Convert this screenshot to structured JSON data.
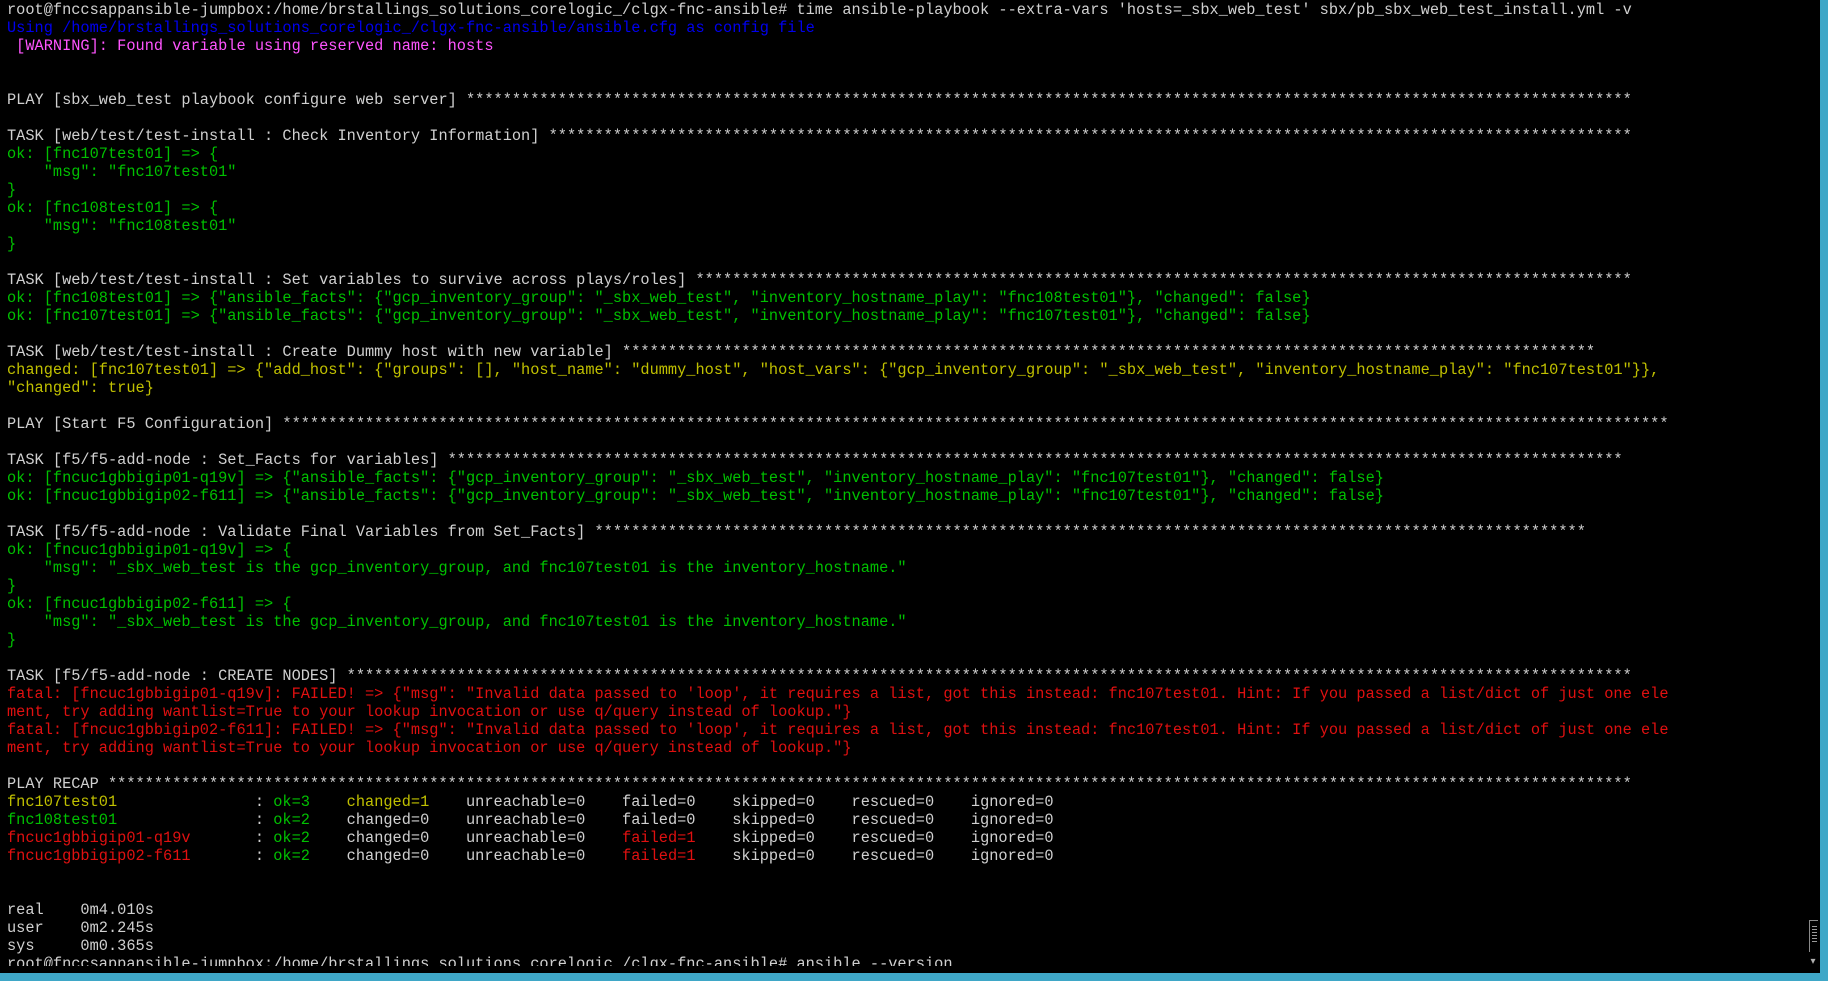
{
  "colors": {
    "default": "#d0d0d0",
    "info_blue": "#0000ee",
    "warning": "#ff55ff",
    "ok": "#00c000",
    "changed": "#c0c000",
    "fatal": "#e01010"
  },
  "icons": {
    "scroll_down": "▾"
  },
  "lines": [
    [
      {
        "t": "root@fnccsappansible-jumpbox:/home/brstallings_solutions_corelogic_/clgx-fnc-ansible# time ansible-playbook --extra-vars 'hosts=_sbx_web_test' sbx/pb_sbx_web_test_install.yml -v",
        "c": "default"
      }
    ],
    [
      {
        "t": "Using /home/brstallings_solutions_corelogic_/clgx-fnc-ansible/ansible.cfg as config file",
        "c": "info_blue"
      }
    ],
    [
      {
        "t": " [WARNING]: Found variable using reserved name: hosts",
        "c": "warning"
      }
    ],
    [],
    [],
    [
      {
        "t": "PLAY [sbx_web_test playbook configure web server] *******************************************************************************************************************************",
        "c": "default"
      }
    ],
    [],
    [
      {
        "t": "TASK [web/test/test-install : Check Inventory Information] **********************************************************************************************************************",
        "c": "default"
      }
    ],
    [
      {
        "t": "ok: [fnc107test01] => {",
        "c": "ok"
      }
    ],
    [
      {
        "t": "    \"msg\": \"fnc107test01\"",
        "c": "ok"
      }
    ],
    [
      {
        "t": "}",
        "c": "ok"
      }
    ],
    [
      {
        "t": "ok: [fnc108test01] => {",
        "c": "ok"
      }
    ],
    [
      {
        "t": "    \"msg\": \"fnc108test01\"",
        "c": "ok"
      }
    ],
    [
      {
        "t": "}",
        "c": "ok"
      }
    ],
    [],
    [
      {
        "t": "TASK [web/test/test-install : Set variables to survive across plays/roles] ******************************************************************************************************",
        "c": "default"
      }
    ],
    [
      {
        "t": "ok: [fnc108test01] => {\"ansible_facts\": {\"gcp_inventory_group\": \"_sbx_web_test\", \"inventory_hostname_play\": \"fnc108test01\"}, \"changed\": false}",
        "c": "ok"
      }
    ],
    [
      {
        "t": "ok: [fnc107test01] => {\"ansible_facts\": {\"gcp_inventory_group\": \"_sbx_web_test\", \"inventory_hostname_play\": \"fnc107test01\"}, \"changed\": false}",
        "c": "ok"
      }
    ],
    [],
    [
      {
        "t": "TASK [web/test/test-install : Create Dummy host with new variable] **********************************************************************************************************",
        "c": "default"
      }
    ],
    [
      {
        "t": "changed: [fnc107test01] => {\"add_host\": {\"groups\": [], \"host_name\": \"dummy_host\", \"host_vars\": {\"gcp_inventory_group\": \"_sbx_web_test\", \"inventory_hostname_play\": \"fnc107test01\"}},",
        "c": "changed"
      }
    ],
    [
      {
        "t": "\"changed\": true}",
        "c": "changed"
      }
    ],
    [],
    [
      {
        "t": "PLAY [Start F5 Configuration] *******************************************************************************************************************************************************",
        "c": "default"
      }
    ],
    [],
    [
      {
        "t": "TASK [f5/f5-add-node : Set_Facts for variables] ********************************************************************************************************************************",
        "c": "default"
      }
    ],
    [
      {
        "t": "ok: [fncuc1gbbigip01-q19v] => {\"ansible_facts\": {\"gcp_inventory_group\": \"_sbx_web_test\", \"inventory_hostname_play\": \"fnc107test01\"}, \"changed\": false}",
        "c": "ok"
      }
    ],
    [
      {
        "t": "ok: [fncuc1gbbigip02-f611] => {\"ansible_facts\": {\"gcp_inventory_group\": \"_sbx_web_test\", \"inventory_hostname_play\": \"fnc107test01\"}, \"changed\": false}",
        "c": "ok"
      }
    ],
    [],
    [
      {
        "t": "TASK [f5/f5-add-node : Validate Final Variables from Set_Facts] ************************************************************************************************************",
        "c": "default"
      }
    ],
    [
      {
        "t": "ok: [fncuc1gbbigip01-q19v] => {",
        "c": "ok"
      }
    ],
    [
      {
        "t": "    \"msg\": \"_sbx_web_test is the gcp_inventory_group, and fnc107test01 is the inventory_hostname.\"",
        "c": "ok"
      }
    ],
    [
      {
        "t": "}",
        "c": "ok"
      }
    ],
    [
      {
        "t": "ok: [fncuc1gbbigip02-f611] => {",
        "c": "ok"
      }
    ],
    [
      {
        "t": "    \"msg\": \"_sbx_web_test is the gcp_inventory_group, and fnc107test01 is the inventory_hostname.\"",
        "c": "ok"
      }
    ],
    [
      {
        "t": "}",
        "c": "ok"
      }
    ],
    [],
    [
      {
        "t": "TASK [f5/f5-add-node : CREATE NODES] ********************************************************************************************************************************************",
        "c": "default"
      }
    ],
    [
      {
        "t": "fatal: [fncuc1gbbigip01-q19v]: FAILED! => {\"msg\": \"Invalid data passed to 'loop', it requires a list, got this instead: fnc107test01. Hint: If you passed a list/dict of just one ele",
        "c": "fatal"
      }
    ],
    [
      {
        "t": "ment, try adding wantlist=True to your lookup invocation or use q/query instead of lookup.\"}",
        "c": "fatal"
      }
    ],
    [
      {
        "t": "fatal: [fncuc1gbbigip02-f611]: FAILED! => {\"msg\": \"Invalid data passed to 'loop', it requires a list, got this instead: fnc107test01. Hint: If you passed a list/dict of just one ele",
        "c": "fatal"
      }
    ],
    [
      {
        "t": "ment, try adding wantlist=True to your lookup invocation or use q/query instead of lookup.\"}",
        "c": "fatal"
      }
    ],
    [],
    [
      {
        "t": "PLAY RECAP **********************************************************************************************************************************************************************",
        "c": "default"
      }
    ],
    [
      {
        "t": "fnc107test01              ",
        "c": "changed"
      },
      {
        "t": " : ",
        "c": "default"
      },
      {
        "t": "ok=3   ",
        "c": "ok"
      },
      {
        "t": " changed=1   ",
        "c": "changed"
      },
      {
        "t": " unreachable=0    failed=0    skipped=0    rescued=0    ignored=0",
        "c": "default"
      }
    ],
    [
      {
        "t": "fnc108test01              ",
        "c": "ok"
      },
      {
        "t": " : ",
        "c": "default"
      },
      {
        "t": "ok=2   ",
        "c": "ok"
      },
      {
        "t": " changed=0    unreachable=0    failed=0    skipped=0    rescued=0    ignored=0",
        "c": "default"
      }
    ],
    [
      {
        "t": "fncuc1gbbigip01-q19v      ",
        "c": "fatal"
      },
      {
        "t": " : ",
        "c": "default"
      },
      {
        "t": "ok=2   ",
        "c": "ok"
      },
      {
        "t": " changed=0    unreachable=0    ",
        "c": "default"
      },
      {
        "t": "failed=1",
        "c": "fatal"
      },
      {
        "t": "    skipped=0    rescued=0    ignored=0",
        "c": "default"
      }
    ],
    [
      {
        "t": "fncuc1gbbigip02-f611      ",
        "c": "fatal"
      },
      {
        "t": " : ",
        "c": "default"
      },
      {
        "t": "ok=2   ",
        "c": "ok"
      },
      {
        "t": " changed=0    unreachable=0    ",
        "c": "default"
      },
      {
        "t": "failed=1",
        "c": "fatal"
      },
      {
        "t": "    skipped=0    rescued=0    ignored=0",
        "c": "default"
      }
    ],
    [],
    [],
    [
      {
        "t": "real    0m4.010s",
        "c": "default"
      }
    ],
    [
      {
        "t": "user    0m2.245s",
        "c": "default"
      }
    ],
    [
      {
        "t": "sys     0m0.365s",
        "c": "default"
      }
    ],
    [
      {
        "t": "root@fnccsappansible-jumpbox:/home/brstallings_solutions_corelogic_/clgx-fnc-ansible# ansible --version",
        "c": "default"
      }
    ]
  ]
}
